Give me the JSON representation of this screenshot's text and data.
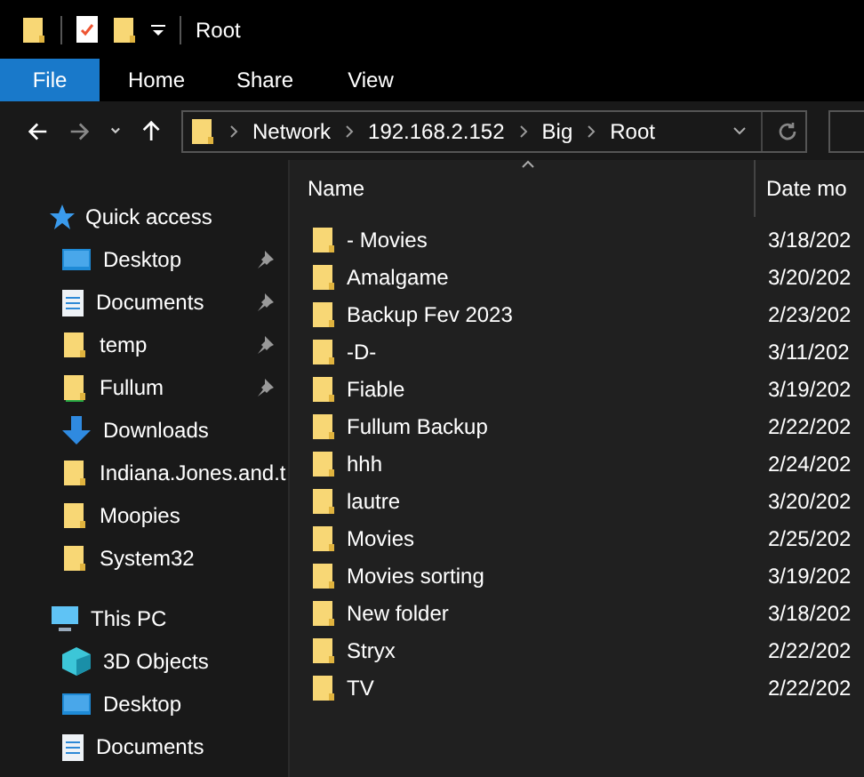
{
  "window": {
    "title": "Root"
  },
  "ribbon_tabs": [
    {
      "label": "File",
      "selected": true
    },
    {
      "label": "Home",
      "selected": false
    },
    {
      "label": "Share",
      "selected": false
    },
    {
      "label": "View",
      "selected": false
    }
  ],
  "address_bar": {
    "path": [
      "Network",
      "192.168.2.152",
      "Big",
      "Root"
    ]
  },
  "sidebar": {
    "sections": [
      {
        "label": "Quick access",
        "kind": "star",
        "items": [
          {
            "label": "Desktop",
            "kind": "desktop",
            "pinned": true
          },
          {
            "label": "Documents",
            "kind": "documents",
            "pinned": true
          },
          {
            "label": "temp",
            "kind": "folder",
            "pinned": true
          },
          {
            "label": "Fullum",
            "kind": "network-folder",
            "pinned": true
          },
          {
            "label": "Downloads",
            "kind": "download",
            "pinned": false
          },
          {
            "label": "Indiana.Jones.and.t",
            "kind": "folder",
            "pinned": false
          },
          {
            "label": "Moopies",
            "kind": "folder",
            "pinned": false
          },
          {
            "label": "System32",
            "kind": "folder",
            "pinned": false
          }
        ]
      },
      {
        "label": "This PC",
        "kind": "pc",
        "items": [
          {
            "label": "3D Objects",
            "kind": "objects",
            "pinned": false
          },
          {
            "label": "Desktop",
            "kind": "desktop",
            "pinned": false
          },
          {
            "label": "Documents",
            "kind": "documents",
            "pinned": false
          }
        ]
      }
    ]
  },
  "file_list": {
    "columns": [
      "Name",
      "Date mo"
    ],
    "rows": [
      {
        "name": "- Movies",
        "date": "3/18/202"
      },
      {
        "name": "Amalgame",
        "date": "3/20/202"
      },
      {
        "name": "Backup Fev 2023",
        "date": "2/23/202"
      },
      {
        "name": "-D-",
        "date": "3/11/202"
      },
      {
        "name": "Fiable",
        "date": "3/19/202"
      },
      {
        "name": "Fullum Backup",
        "date": "2/22/202"
      },
      {
        "name": "hhh",
        "date": "2/24/202"
      },
      {
        "name": "lautre",
        "date": "3/20/202"
      },
      {
        "name": "Movies",
        "date": "2/25/202"
      },
      {
        "name": "Movies sorting",
        "date": "3/19/202"
      },
      {
        "name": "New folder",
        "date": "3/18/202"
      },
      {
        "name": "Stryx",
        "date": "2/22/202"
      },
      {
        "name": "TV",
        "date": "2/22/202"
      }
    ]
  }
}
